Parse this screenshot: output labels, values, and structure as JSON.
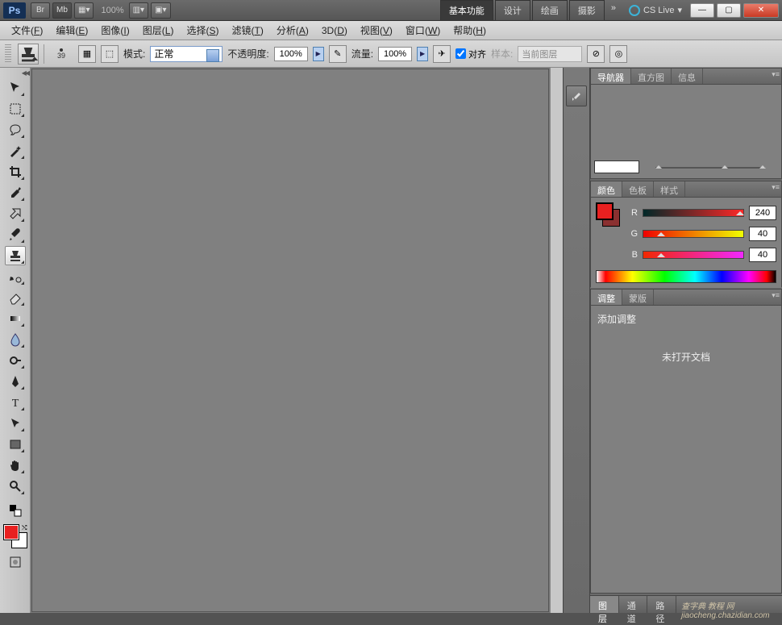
{
  "titlebar": {
    "zoom": "100%",
    "workspaces": [
      "基本功能",
      "设计",
      "绘画",
      "摄影"
    ],
    "active_workspace": 0,
    "cslive": "CS Live"
  },
  "menubar": {
    "items": [
      {
        "label": "文件",
        "key": "F"
      },
      {
        "label": "编辑",
        "key": "E"
      },
      {
        "label": "图像",
        "key": "I"
      },
      {
        "label": "图层",
        "key": "L"
      },
      {
        "label": "选择",
        "key": "S"
      },
      {
        "label": "滤镜",
        "key": "T"
      },
      {
        "label": "分析",
        "key": "A"
      },
      {
        "label": "3D",
        "key": "D"
      },
      {
        "label": "视图",
        "key": "V"
      },
      {
        "label": "窗口",
        "key": "W"
      },
      {
        "label": "帮助",
        "key": "H"
      }
    ]
  },
  "options": {
    "brush_size": "39",
    "mode_label": "模式:",
    "mode_value": "正常",
    "opacity_label": "不透明度:",
    "opacity_value": "100%",
    "flow_label": "流量:",
    "flow_value": "100%",
    "align_label": "对齐",
    "sample_label": "样本:",
    "sample_value": "当前图层"
  },
  "tools": [
    "move",
    "marquee",
    "lasso",
    "wand",
    "crop",
    "eyedropper",
    "healing",
    "brush",
    "stamp",
    "history-brush",
    "eraser",
    "gradient",
    "blur",
    "dodge",
    "pen",
    "type",
    "path-select",
    "rectangle",
    "hand",
    "zoom"
  ],
  "colors": {
    "fg": "#e82020",
    "bg": "#ffffff",
    "panel_fg": "#e82020",
    "panel_bg": "#8a3030"
  },
  "panels": {
    "nav_tabs": [
      "导航器",
      "直方图",
      "信息"
    ],
    "color_tabs": [
      "颜色",
      "色板",
      "样式"
    ],
    "adj_tabs": [
      "调整",
      "蒙版"
    ],
    "bottom_tabs": [
      "图层",
      "通道",
      "路径"
    ],
    "rgb": {
      "r_label": "R",
      "g_label": "G",
      "b_label": "B",
      "r": "240",
      "g": "40",
      "b": "40"
    },
    "adj_title": "添加调整",
    "adj_empty": "未打开文档"
  },
  "watermark": "查字典 教程 网\njiaocheng.chazidian.com"
}
